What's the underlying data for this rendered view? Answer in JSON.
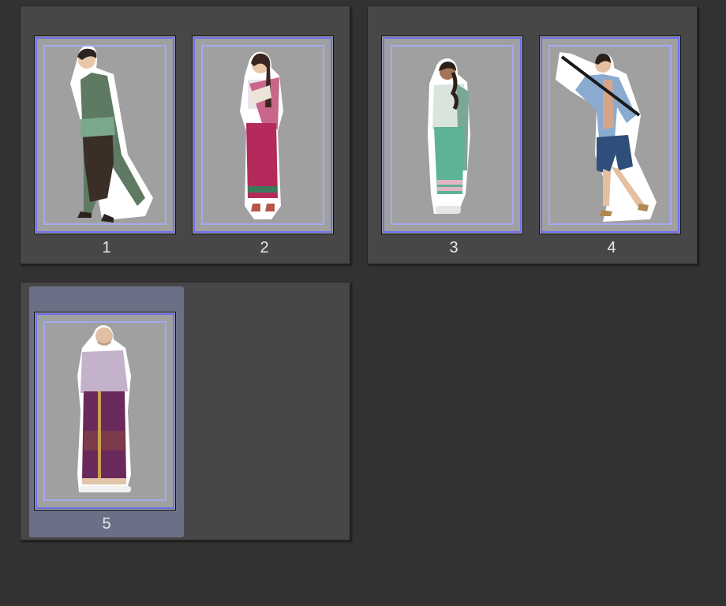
{
  "panel": {
    "title": ""
  },
  "spreads": [
    {
      "pages": [
        {
          "number": "1",
          "figure": "standing-man-green-robe",
          "selected": false
        },
        {
          "number": "2",
          "figure": "woman-pink-sarong-with-fan",
          "selected": false
        }
      ]
    },
    {
      "pages": [
        {
          "number": "3",
          "figure": "woman-green-dress-braid",
          "selected": false
        },
        {
          "number": "4",
          "figure": "man-with-sword-blue-shirt",
          "selected": false
        }
      ]
    },
    {
      "pages": [
        {
          "number": "5",
          "figure": "elder-man-purple-robe",
          "selected": true
        }
      ]
    }
  ],
  "colors": {
    "background": "#323232",
    "spread": "#474747",
    "page": "#9fa09f",
    "bleed_guide": "#6d6ff0",
    "margin_guide": "#a6a8f2",
    "selection": "#6a7186"
  }
}
